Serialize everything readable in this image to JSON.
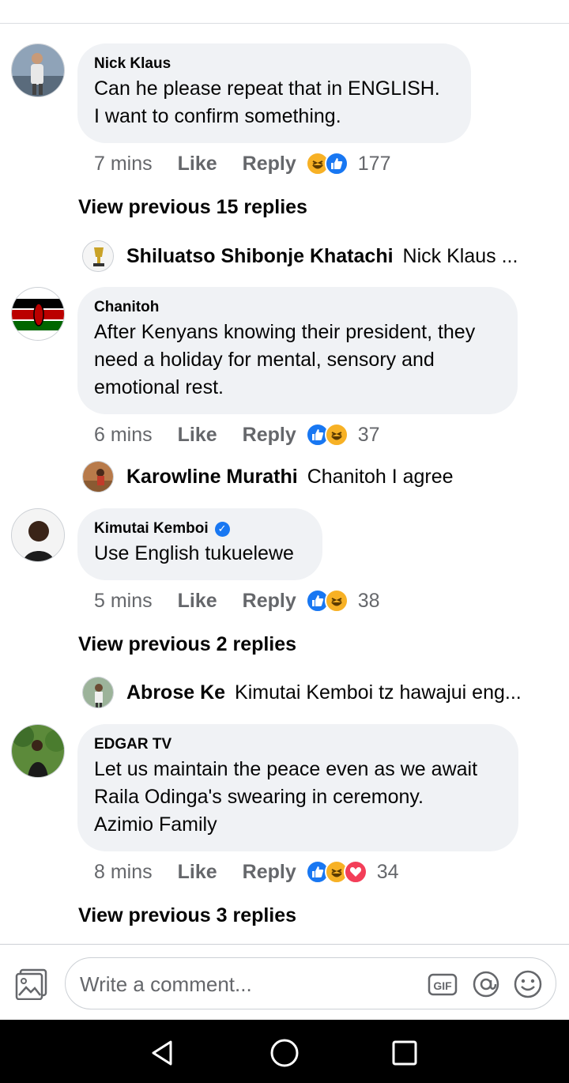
{
  "header": {
    "title_fragment": "· · ·"
  },
  "comments": [
    {
      "name": "Nick Klaus",
      "text": "Can he please repeat that in ENGLISH.\nI want to confirm something.",
      "time": "7 mins",
      "like": "Like",
      "reply": "Reply",
      "reactions": [
        "haha",
        "like"
      ],
      "count": "177",
      "view_previous": "View previous 15 replies",
      "reply_preview": {
        "name": "Shiluatso Shibonje Khatachi",
        "text": "Nick Klaus ..."
      }
    },
    {
      "name": "Chanitoh",
      "text": "After Kenyans knowing their president, they\nneed a holiday for mental, sensory and\nemotional rest.",
      "time": "6 mins",
      "like": "Like",
      "reply": "Reply",
      "reactions": [
        "like",
        "haha"
      ],
      "count": "37",
      "reply_preview": {
        "name": "Karowline Murathi",
        "text": "Chanitoh I agree"
      }
    },
    {
      "name": "Kimutai Kemboi",
      "verified": true,
      "text": "Use English tukuelewe",
      "time": "5 mins",
      "like": "Like",
      "reply": "Reply",
      "reactions": [
        "like",
        "haha"
      ],
      "count": "38",
      "view_previous": "View previous 2 replies",
      "reply_preview": {
        "name": "Abrose Ke",
        "text": "Kimutai Kemboi tz hawajui eng..."
      }
    },
    {
      "name": "EDGAR TV",
      "text": "Let us maintain the peace even as we await\nRaila Odinga's swearing in ceremony.\nAzimio Family",
      "time": "8 mins",
      "like": "Like",
      "reply": "Reply",
      "reactions": [
        "like",
        "haha",
        "love"
      ],
      "count": "34",
      "view_previous": "View previous 3 replies"
    }
  ],
  "composer": {
    "placeholder": "Write a comment...",
    "icons": [
      "photo-icon",
      "gif-icon",
      "mention-icon",
      "emoji-icon"
    ]
  },
  "navbar": {
    "icons": [
      "back-icon",
      "home-icon",
      "recents-icon"
    ]
  },
  "colors": {
    "bubble": "#f0f2f5",
    "meta": "#65676b",
    "like": "#1877f2",
    "haha": "#f7b125",
    "love": "#f33e58"
  }
}
